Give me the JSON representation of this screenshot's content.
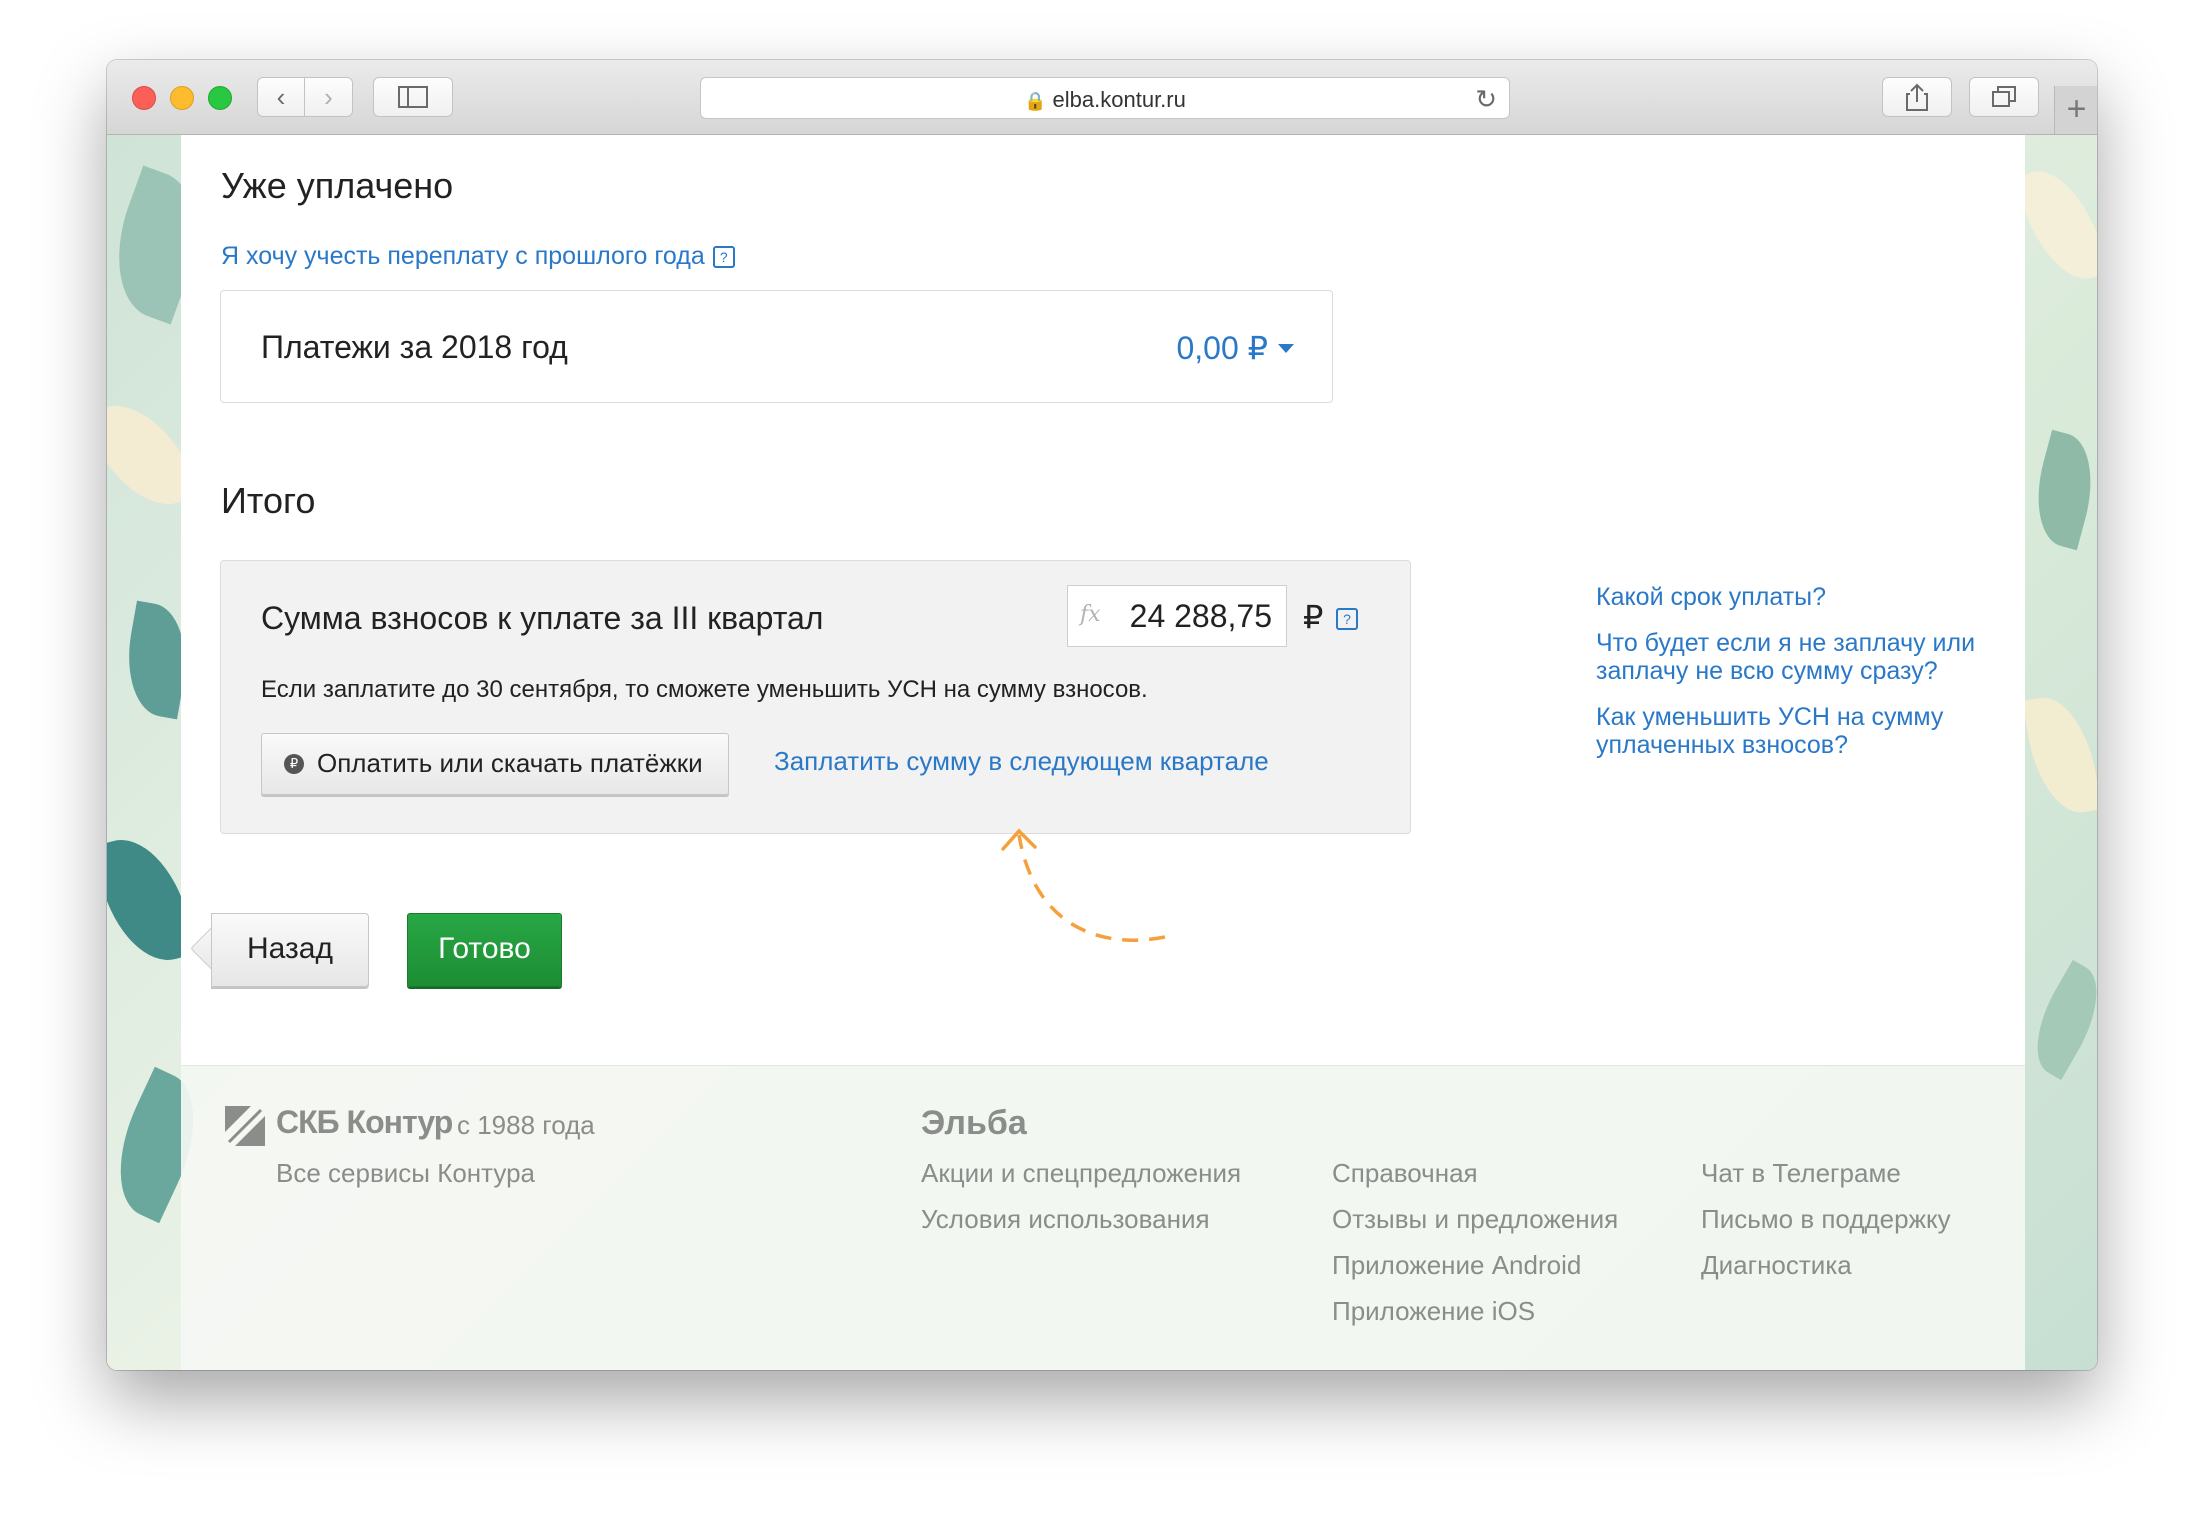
{
  "browser": {
    "url": "elba.kontur.ru"
  },
  "already_paid": {
    "heading": "Уже уплачено",
    "overpay_link": "Я хочу учесть переплату с прошлого года",
    "payments_label": "Платежи за 2018 год",
    "payments_amount": "0,00 ₽"
  },
  "total": {
    "heading": "Итого",
    "sum_label": "Сумма взносов к уплате за III квартал",
    "sum_value": "24 288,75",
    "currency": "₽",
    "note": "Если заплатите до 30 сентября, то сможете уменьшить УСН на сумму взносов.",
    "pay_button": "Оплатить или скачать платёжки",
    "next_quarter_link": "Заплатить сумму в следующем квартале"
  },
  "help_links": [
    "Какой срок уплаты?",
    "Что будет если я не заплачу или заплачу не всю сумму сразу?",
    "Как уменьшить УСН на сумму уплаченных взносов?"
  ],
  "actions": {
    "back": "Назад",
    "done": "Готово"
  },
  "footer": {
    "brand": "СКБ Контур",
    "since": "с 1988 года",
    "all_services": "Все сервисы Контура",
    "elba": "Эльба",
    "col1": [
      "Акции и спецпредложения",
      "Условия использования"
    ],
    "col2": [
      "Справочная",
      "Отзывы и предложения",
      "Приложение Android",
      "Приложение iOS"
    ],
    "col3": [
      "Чат в Телеграме",
      "Письмо в поддержку",
      "Диагностика"
    ]
  },
  "colors": {
    "link": "#2a78c8",
    "done_button": "#22993d",
    "arrow": "#f5a03a"
  }
}
